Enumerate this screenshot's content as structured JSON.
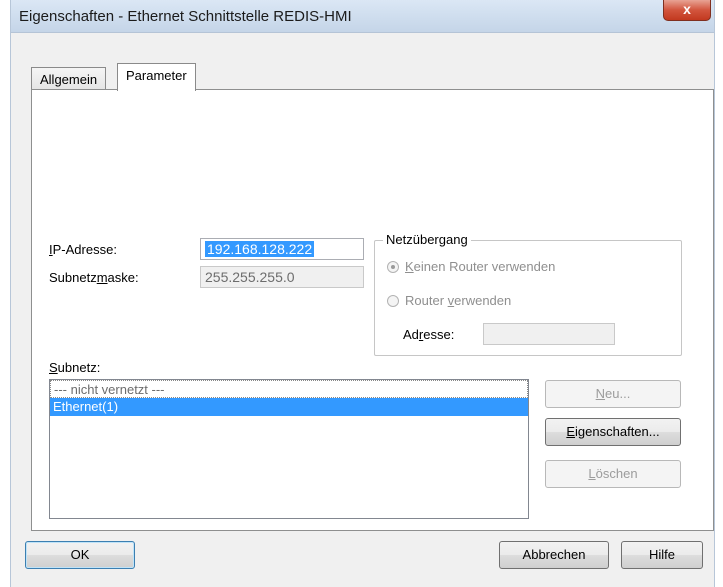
{
  "window": {
    "title": "Eigenschaften - Ethernet Schnittstelle  REDIS-HMI",
    "close_label": "x"
  },
  "tabs": [
    {
      "label": "Allgemein",
      "active": false
    },
    {
      "label": "Parameter",
      "active": true
    }
  ],
  "ip": {
    "label_prefix": "I",
    "label_rest": "P-Adresse:",
    "value": "192.168.128.222"
  },
  "subnetmask": {
    "label_a": "Subnetz",
    "label_u": "m",
    "label_b": "aske:",
    "value": "255.255.255.0"
  },
  "gateway": {
    "title": "Netzübergang",
    "no_router": {
      "u": "K",
      "rest": "einen Router verwenden",
      "checked": true
    },
    "use_router": {
      "a": "Router ",
      "u": "v",
      "b": "erwenden",
      "checked": false
    },
    "address_label_a": "Ad",
    "address_label_u": "r",
    "address_label_b": "esse:",
    "address_value": ""
  },
  "subnet": {
    "label_u": "S",
    "label_rest": "ubnetz:",
    "items": [
      "--- nicht vernetzt ---",
      "Ethernet(1)"
    ],
    "selected_index": 1
  },
  "side_buttons": {
    "new": {
      "u": "N",
      "rest": "eu..."
    },
    "properties": {
      "u": "E",
      "rest": "igenschaften..."
    },
    "delete": {
      "u": "L",
      "rest": "öschen"
    }
  },
  "footer": {
    "ok": "OK",
    "cancel": "Abbrechen",
    "help": "Hilfe"
  },
  "colors": {
    "selection": "#3399ff",
    "close_button": "#c9472f"
  }
}
